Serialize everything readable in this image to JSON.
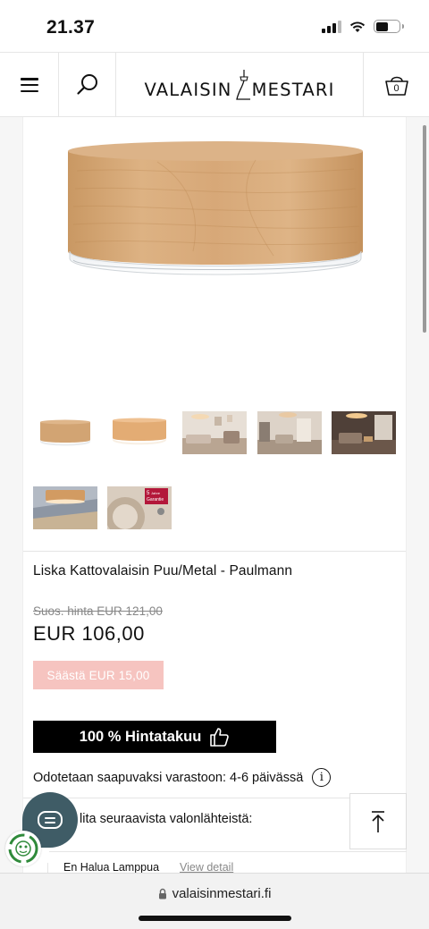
{
  "status_bar": {
    "time": "21.37"
  },
  "header": {
    "logo_left": "VALAISIN",
    "logo_right": "MESTARI",
    "cart_count": "0"
  },
  "product": {
    "title": "Liska Kattovalaisin Puu/Metal - Paulmann",
    "old_price": "Suos. hinta EUR 121,00",
    "price": "EUR 106,00",
    "savings": "Säästä EUR 15,00",
    "guarantee": "100 % Hintatakuu",
    "stock_status": "Odotetaan saapuvaksi varastoon: 4-6 päivässä",
    "info_symbol": "i",
    "choose_heading": "Valitse yksi seuraavista valonlähteistä:",
    "choose_heading_visible": "lita seuraavista valonlähteistä:",
    "light_source_option": "En Halua Lamppua",
    "view_detail": "View detail"
  },
  "thumbnails": [
    {
      "name": "thumb-1",
      "kind": "lamp-wood"
    },
    {
      "name": "thumb-2",
      "kind": "lamp-wood-lit"
    },
    {
      "name": "thumb-3",
      "kind": "living-room"
    },
    {
      "name": "thumb-4",
      "kind": "living-room-2"
    },
    {
      "name": "thumb-5",
      "kind": "living-room-3"
    },
    {
      "name": "thumb-6",
      "kind": "lamp-ceiling"
    },
    {
      "name": "thumb-7",
      "kind": "guarantee-badge"
    }
  ],
  "guarantee_badge": {
    "line1": "5",
    "line2": "Jahre",
    "line3": "Garantie"
  },
  "browser": {
    "url": "valaisinmestari.fi"
  },
  "colors": {
    "save_badge": "#f6c4c0",
    "guarantee_bg": "#000000",
    "chat_bubble": "#3f5c66",
    "wood": "#d2a473"
  }
}
